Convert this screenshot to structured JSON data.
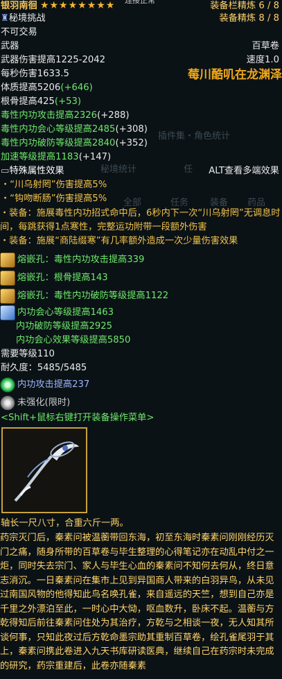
{
  "header": {
    "item_name": "银羽南徊",
    "stars": "★★★★★★★★",
    "status_peek": "连接正常",
    "refine1_label": "装备栏精炼",
    "refine1_value": "6 / 8",
    "refine2_label": "装备精炼",
    "refine2_value": "8 / 8",
    "event_tag": "秘境挑战",
    "trade_status": "不可交易",
    "type": "武器",
    "category": "百草卷",
    "speed": "速度1.0"
  },
  "base_stats": [
    {
      "text": "武器伤害提高1225-2042",
      "bonus": ""
    },
    {
      "text": "每秒伤害1633.5",
      "bonus": ""
    },
    {
      "text": "体质提高5206",
      "bonus": "(+646)"
    },
    {
      "text": "根骨提高425",
      "bonus": "(+53)"
    }
  ],
  "green_stats": [
    {
      "text": "毒性内功攻击提高2326",
      "bonus": "(+288)"
    },
    {
      "text": "毒性内功会心等级提高2485",
      "bonus": "(+308)"
    },
    {
      "text": "毒性内功破防等级提高2840",
      "bonus": "(+352)"
    },
    {
      "text": "加速等级提高1183",
      "bonus": "(+147)"
    }
  ],
  "overlay_text": "莓川酷叽在龙渊泽",
  "special": {
    "title": "特殊属性效果",
    "alt_hint": "ALT查看多端效果",
    "lines": [
      "・“川乌射罔”伤害提高5%",
      "・“钩吻断肠”伤害提高5%",
      "・装备：施展毒性内功招式命中后，6秒内下一次“川乌射罔”无调息时间，每跳获得1点寒性，完整运功附带一段额外伤害",
      "・装备：施展“商陆缀寒”有几率额外造成一次少量伤害效果"
    ]
  },
  "gems": [
    {
      "icon": "gold-gem-icon",
      "text": "熔嵌孔：毒性内功攻击提高339"
    },
    {
      "icon": "gold-gem-icon",
      "text": "熔嵌孔：根骨提高143"
    },
    {
      "icon": "gold-gem-icon",
      "text": "熔嵌孔：毒性内功破防等级提高1122"
    }
  ],
  "big_gem": {
    "lines": [
      "内功会心等级提高1463",
      "内功破防等级提高2925",
      "内功会心效果等级提高5850"
    ]
  },
  "requirements": {
    "level": "需要等级110",
    "durability": "耐久度：5485/5485"
  },
  "enchant": "内功攻击提高237",
  "enhance": "未强化(限时)",
  "shift_hint": "<Shift+鼠标右键打开装备操作菜单>",
  "item_desc_size": "轴长一尺八寸，合重六斤一两。",
  "lore": "药宗灭门后，秦素问被温蘅带回东海，初至东海时秦素问刚刚经历灭门之痛，随身所带的百草卷与毕生整理的心得笔记亦在动乱中付之一炬，同时失去宗门、家人与毕生心血的秦素问不知何去何从，终日意志消沉。一日秦素问在集市上见到异国商人带来的白羽异鸟，从未见过南国风物的他得知此鸟名唤孔雀，来自遥远的天竺，想到自己亦是千里之外漂泊至此，一时心中大恸，呕血数升，卧床不起。温蘅与方乾得知后前往秦素问住处为其治疗，方乾与之相谈一夜，无人知其所谈何事，只知此夜过后方乾命墨宗助其重制百草卷，绘孔雀尾羽于其上，秦素问携此卷进入九天书库研读医典，继续自己在药宗时未完成的研究，药宗重建后，此卷亦随秦素",
  "background_ghosts": [
    "插件集・角色统计",
    "秘境统计",
    "任",
    "全部",
    "任务",
    "装备",
    "药品"
  ],
  "colors": {
    "gold_title": "#f0c35a",
    "green_stat": "#6ee86a",
    "orange": "#f2c24a",
    "lore": "#ffd36a",
    "blue": "#9db4ff"
  }
}
